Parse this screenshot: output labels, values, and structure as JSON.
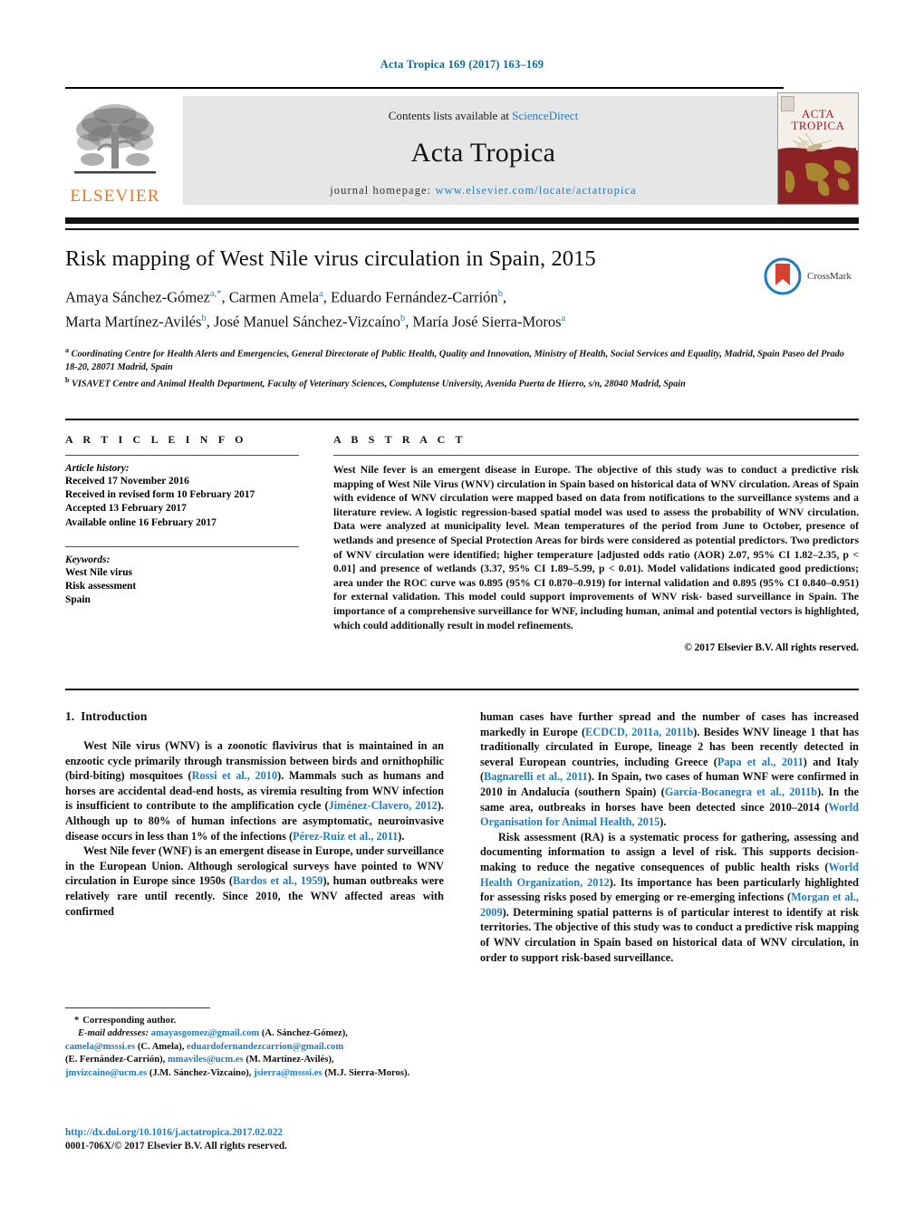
{
  "running_head": "Acta Tropica 169 (2017) 163–169",
  "masthead": {
    "contents_prefix": "Contents lists available at ",
    "sciencedirect": "ScienceDirect",
    "journal_name": "Acta Tropica",
    "homepage_label": "journal homepage: ",
    "homepage_url": "www.elsevier.com/locate/actatropica",
    "publisher_wordmark": "ELSEVIER",
    "cover_title_line1": "ACTA",
    "cover_title_line2": "TROPICA",
    "accent_blue": "#1f7bbf",
    "publisher_orange": "#e87722",
    "cover_red": "#8d2225"
  },
  "article": {
    "title": "Risk mapping of West Nile virus circulation in Spain, 2015",
    "authors_line1": "Amaya Sánchez-Gómez",
    "authors_line1_sup": "a,*",
    "authors_line1_rest": ", Carmen Amela",
    "crossmark_label": "CrossMark",
    "authors": [
      {
        "name": "Amaya Sánchez-Gómez",
        "sup": "a,*"
      },
      {
        "name": "Carmen Amela",
        "sup": "a"
      },
      {
        "name": "Eduardo Fernández-Carrión",
        "sup": "b"
      },
      {
        "name": "Marta Martínez-Avilés",
        "sup": "b"
      },
      {
        "name": "José Manuel Sánchez-Vizcaíno",
        "sup": "b"
      },
      {
        "name": "María José Sierra-Moros",
        "sup": "a"
      }
    ],
    "affiliations": [
      {
        "sup": "a",
        "text": "Coordinating Centre for Health Alerts and Emergencies, General Directorate of Public Health, Quality and Innovation, Ministry of Health, Social Services and Equality, Madrid, Spain Paseo del Prado 18-20, 28071 Madrid, Spain"
      },
      {
        "sup": "b",
        "text": "VISAVET Centre and Animal Health Department, Faculty of Veterinary Sciences, Complutense University, Avenida Puerta de Hierro, s/n, 28040 Madrid, Spain"
      }
    ]
  },
  "article_info": {
    "heading": "A R T I C L E   I N F O",
    "history_title": "Article history:",
    "history": [
      "Received 17 November 2016",
      "Received in revised form 10 February 2017",
      "Accepted 13 February 2017",
      "Available online 16 February 2017"
    ],
    "keywords_title": "Keywords:",
    "keywords": [
      "West Nile virus",
      "Risk assessment",
      "Spain"
    ]
  },
  "abstract": {
    "heading": "A B S T R A C T",
    "text": "West Nile fever is an emergent disease in Europe. The objective of this study was to conduct a predictive risk mapping of West Nile Virus (WNV) circulation in Spain based on historical data of WNV circulation. Areas of Spain with evidence of WNV circulation were mapped based on data from notifications to the surveillance systems and a literature review. A logistic regression-based spatial model was used to assess the probability of WNV circulation. Data were analyzed at municipality level. Mean temperatures of the period from June to October, presence of wetlands and presence of Special Protection Areas for birds were considered as potential predictors. Two predictors of WNV circulation were identified; higher temperature [adjusted odds ratio (AOR) 2.07, 95% CI 1.82–2.35, p < 0.01] and presence of wetlands (3.37, 95% CI 1.89–5.99, p < 0.01). Model validations indicated good predictions; area under the ROC curve was 0.895 (95% CI 0.870–0.919) for internal validation and 0.895 (95% CI 0.840–0.951) for external validation. This model could support improvements of WNV risk- based surveillance in Spain. The importance of a comprehensive surveillance for WNF, including human, animal and potential vectors is highlighted, which could additionally result in model refinements.",
    "copyright": "© 2017 Elsevier B.V. All rights reserved."
  },
  "introduction": {
    "number": "1.",
    "heading": "Introduction",
    "left_paragraphs": [
      {
        "segments": [
          {
            "t": "West Nile virus (WNV) is a zoonotic flavivirus that is maintained in an enzootic cycle primarily through transmission between birds and ornithophilic (bird-biting) mosquitoes (",
            "cite": false
          },
          {
            "t": "Rossi et al., 2010",
            "cite": true
          },
          {
            "t": "). Mammals such as humans and horses are accidental dead-end hosts, as viremia resulting from WNV infection is insufficient to contribute to the amplification cycle (",
            "cite": false
          },
          {
            "t": "Jiménez-Clavero, 2012",
            "cite": true
          },
          {
            "t": "). Although up to 80% of human infections are asymptomatic, neuroinvasive disease occurs in less than 1% of the infections (",
            "cite": false
          },
          {
            "t": "Pérez-Ruiz et al., 2011",
            "cite": true
          },
          {
            "t": ").",
            "cite": false
          }
        ]
      },
      {
        "segments": [
          {
            "t": "West Nile fever (WNF) is an emergent disease in Europe, under surveillance in the European Union. Although serological surveys have pointed to WNV circulation in Europe since 1950s (",
            "cite": false
          },
          {
            "t": "Bardos et al., 1959",
            "cite": true
          },
          {
            "t": "), human outbreaks were relatively rare until recently. Since 2010, the WNV affected areas with confirmed",
            "cite": false
          }
        ]
      }
    ],
    "right_paragraphs": [
      {
        "segments": [
          {
            "t": "human cases have further spread and the number of cases has increased markedly in Europe (",
            "cite": false
          },
          {
            "t": "ECDCD, 2011a, 2011b",
            "cite": true
          },
          {
            "t": "). Besides WNV lineage 1 that has traditionally circulated in Europe, lineage 2 has been recently detected in several European countries, including Greece (",
            "cite": false
          },
          {
            "t": "Papa et al., 2011",
            "cite": true
          },
          {
            "t": ") and Italy (",
            "cite": false
          },
          {
            "t": "Bagnarelli et al., 2011",
            "cite": true
          },
          {
            "t": "). In Spain, two cases of human WNF were confirmed in 2010 in Andalucía (southern Spain) (",
            "cite": false
          },
          {
            "t": "García-Bocanegra et al., 2011b",
            "cite": true
          },
          {
            "t": "). In the same area, outbreaks in horses have been detected since 2010–2014 (",
            "cite": false
          },
          {
            "t": "World Organisation for Animal Health, 2015",
            "cite": true
          },
          {
            "t": ").",
            "cite": false
          }
        ]
      },
      {
        "segments": [
          {
            "t": "Risk assessment (RA) is a systematic process for gathering, assessing and documenting information to assign a level of risk. This supports decision-making to reduce the negative consequences of public health risks (",
            "cite": false
          },
          {
            "t": "World Health Organization, 2012",
            "cite": true
          },
          {
            "t": "). Its importance has been particularly highlighted for assessing risks posed by emerging or re-emerging infections (",
            "cite": false
          },
          {
            "t": "Morgan et al., 2009",
            "cite": true
          },
          {
            "t": "). Determining spatial patterns is of particular interest to identify at risk territories. The objective of this study was to conduct a predictive risk mapping of WNV circulation in Spain based on historical data of WNV circulation, in order to support risk-based surveillance.",
            "cite": false
          }
        ]
      }
    ]
  },
  "footnotes": {
    "corresponding": "Corresponding author.",
    "email_label": "E-mail addresses:",
    "emails": [
      {
        "address": "amayasgomez@gmail.com",
        "person": "(A. Sánchez-Gómez)"
      },
      {
        "address": "camela@msssi.es",
        "person": "(C. Amela)"
      },
      {
        "address": "eduardofernandezcarrion@gmail.com",
        "person": "(E. Fernández-Carrión)"
      },
      {
        "address": "mmaviles@ucm.es",
        "person": "(M. Martínez-Avilés)"
      },
      {
        "address": "jmvizcaino@ucm.es",
        "person": "(J.M. Sánchez-Vizcaíno)"
      },
      {
        "address": "jsierra@msssi.es",
        "person": "(M.J. Sierra-Moros)"
      }
    ],
    "doi": "http://dx.doi.org/10.1016/j.actatropica.2017.02.022",
    "issn": "0001-706X/© 2017 Elsevier B.V. All rights reserved."
  }
}
